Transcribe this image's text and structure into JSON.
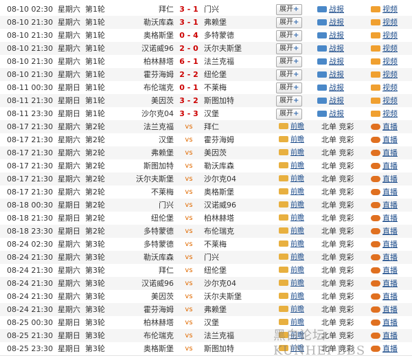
{
  "colors": {
    "score": "#cc0000",
    "link": "#1f4e8c",
    "vs": "#e06a00"
  },
  "labels": {
    "expand": "展开",
    "expand_plus": "+",
    "report": "战报",
    "video": "视频",
    "preview": "前瞻",
    "beidan": "北单",
    "jingcai": "竞彩",
    "live": "直播",
    "vs": "vs"
  },
  "matches": [
    {
      "time": "08-10 02:30",
      "day": "星期六",
      "round": "第1轮",
      "home": "拜仁",
      "score": "3 - 1",
      "away": "门兴",
      "played": true
    },
    {
      "time": "08-10 21:30",
      "day": "星期六",
      "round": "第1轮",
      "home": "勒沃库森",
      "score": "3 - 1",
      "away": "弗赖堡",
      "played": true
    },
    {
      "time": "08-10 21:30",
      "day": "星期六",
      "round": "第1轮",
      "home": "奥格斯堡",
      "score": "0 - 4",
      "away": "多特蒙德",
      "played": true
    },
    {
      "time": "08-10 21:30",
      "day": "星期六",
      "round": "第1轮",
      "home": "汉诺威96",
      "score": "2 - 0",
      "away": "沃尔夫斯堡",
      "played": true
    },
    {
      "time": "08-10 21:30",
      "day": "星期六",
      "round": "第1轮",
      "home": "柏林赫塔",
      "score": "6 - 1",
      "away": "法兰克福",
      "played": true
    },
    {
      "time": "08-10 21:30",
      "day": "星期六",
      "round": "第1轮",
      "home": "霍芬海姆",
      "score": "2 - 2",
      "away": "纽伦堡",
      "played": true
    },
    {
      "time": "08-11 00:30",
      "day": "星期日",
      "round": "第1轮",
      "home": "布伦瑞克",
      "score": "0 - 1",
      "away": "不莱梅",
      "played": true
    },
    {
      "time": "08-11 21:30",
      "day": "星期日",
      "round": "第1轮",
      "home": "美因茨",
      "score": "3 - 2",
      "away": "斯图加特",
      "played": true
    },
    {
      "time": "08-11 23:30",
      "day": "星期日",
      "round": "第1轮",
      "home": "沙尔克04",
      "score": "3 - 3",
      "away": "汉堡",
      "played": true
    },
    {
      "time": "08-17 21:30",
      "day": "星期六",
      "round": "第2轮",
      "home": "法兰克福",
      "away": "拜仁",
      "played": false
    },
    {
      "time": "08-17 21:30",
      "day": "星期六",
      "round": "第2轮",
      "home": "汉堡",
      "away": "霍芬海姆",
      "played": false
    },
    {
      "time": "08-17 21:30",
      "day": "星期六",
      "round": "第2轮",
      "home": "弗赖堡",
      "away": "美因茨",
      "played": false
    },
    {
      "time": "08-17 21:30",
      "day": "星期六",
      "round": "第2轮",
      "home": "斯图加特",
      "away": "勒沃库森",
      "played": false
    },
    {
      "time": "08-17 21:30",
      "day": "星期六",
      "round": "第2轮",
      "home": "沃尔夫斯堡",
      "away": "沙尔克04",
      "played": false
    },
    {
      "time": "08-17 21:30",
      "day": "星期六",
      "round": "第2轮",
      "home": "不莱梅",
      "away": "奥格斯堡",
      "played": false
    },
    {
      "time": "08-18 00:30",
      "day": "星期日",
      "round": "第2轮",
      "home": "门兴",
      "away": "汉诺威96",
      "played": false
    },
    {
      "time": "08-18 21:30",
      "day": "星期日",
      "round": "第2轮",
      "home": "纽伦堡",
      "away": "柏林赫塔",
      "played": false
    },
    {
      "time": "08-18 23:30",
      "day": "星期日",
      "round": "第2轮",
      "home": "多特蒙德",
      "away": "布伦瑞克",
      "played": false
    },
    {
      "time": "08-24 02:30",
      "day": "星期六",
      "round": "第3轮",
      "home": "多特蒙德",
      "away": "不莱梅",
      "played": false
    },
    {
      "time": "08-24 21:30",
      "day": "星期六",
      "round": "第3轮",
      "home": "勒沃库森",
      "away": "门兴",
      "played": false
    },
    {
      "time": "08-24 21:30",
      "day": "星期六",
      "round": "第3轮",
      "home": "拜仁",
      "away": "纽伦堡",
      "played": false
    },
    {
      "time": "08-24 21:30",
      "day": "星期六",
      "round": "第3轮",
      "home": "汉诺威96",
      "away": "沙尔克04",
      "played": false
    },
    {
      "time": "08-24 21:30",
      "day": "星期六",
      "round": "第3轮",
      "home": "美因茨",
      "away": "沃尔夫斯堡",
      "played": false
    },
    {
      "time": "08-24 21:30",
      "day": "星期六",
      "round": "第3轮",
      "home": "霍芬海姆",
      "away": "弗赖堡",
      "played": false
    },
    {
      "time": "08-25 00:30",
      "day": "星期日",
      "round": "第3轮",
      "home": "柏林赫塔",
      "away": "汉堡",
      "played": false
    },
    {
      "time": "08-25 21:30",
      "day": "星期日",
      "round": "第3轮",
      "home": "布伦瑞克",
      "away": "法兰克福",
      "played": false
    },
    {
      "time": "08-25 23:30",
      "day": "星期日",
      "round": "第3轮",
      "home": "奥格斯堡",
      "away": "斯图加特",
      "played": false
    }
  ],
  "watermark": {
    "line1": "黑白论坛",
    "line2": "KUNHEI BBS"
  }
}
